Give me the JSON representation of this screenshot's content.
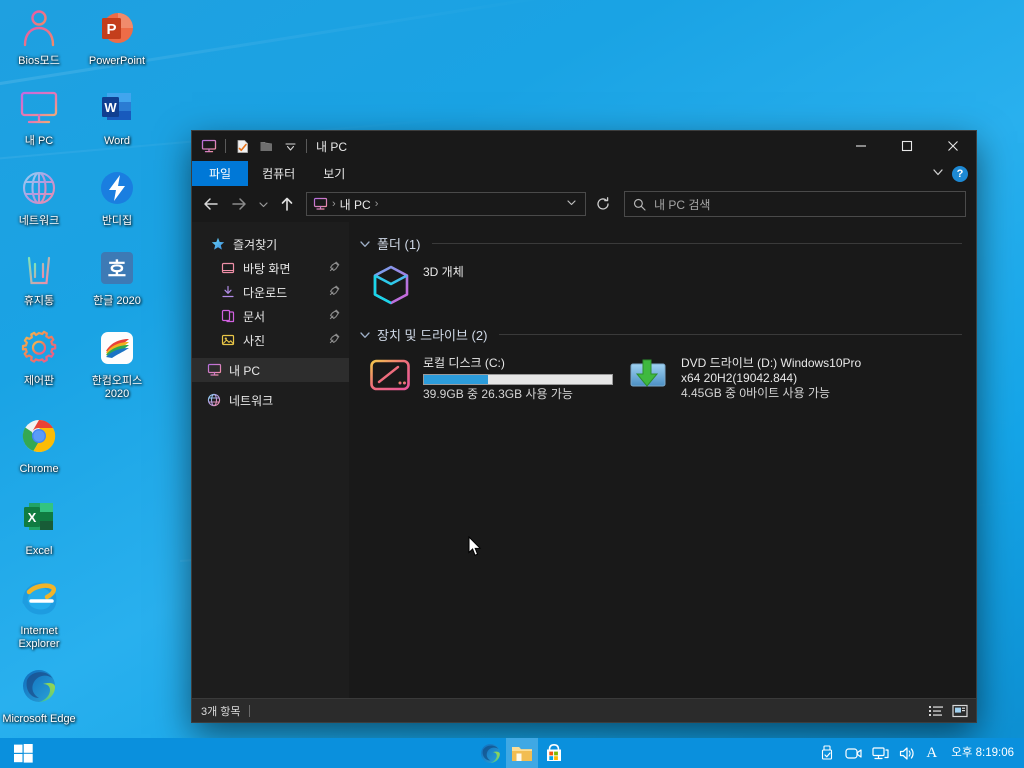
{
  "desktop": {
    "icons": [
      {
        "label": "Bios모드",
        "icon": "person-outline-icon"
      },
      {
        "label": "PowerPoint",
        "icon": "powerpoint-icon"
      },
      {
        "label": "내 PC",
        "icon": "this-pc-icon"
      },
      {
        "label": "Word",
        "icon": "word-icon"
      },
      {
        "label": "네트워크",
        "icon": "network-globe-icon"
      },
      {
        "label": "반디집",
        "icon": "bandizip-icon"
      },
      {
        "label": "휴지통",
        "icon": "recycle-bin-icon"
      },
      {
        "label": "한글 2020",
        "icon": "hangul-icon"
      },
      {
        "label": "제어판",
        "icon": "control-panel-gear-icon"
      },
      {
        "label": "한컴오피스 2020",
        "icon": "hancom-office-icon"
      },
      {
        "label": "Chrome",
        "icon": "chrome-icon"
      },
      {
        "label": "Excel",
        "icon": "excel-icon"
      },
      {
        "label": "Internet Explorer",
        "icon": "internet-explorer-icon"
      },
      {
        "label": "Microsoft Edge",
        "icon": "edge-icon"
      }
    ]
  },
  "explorer": {
    "title": "내 PC",
    "quick_access": {
      "this_pc_icon": "this-pc-icon",
      "properties_icon": "properties-icon",
      "new_folder_icon": "new-folder-icon",
      "customize_icon": "chevron-down-icon"
    },
    "window_controls": {
      "minimize": "—",
      "maximize": "□",
      "close": "✕"
    },
    "ribbon": {
      "tabs": [
        {
          "label": "파일",
          "active": true
        },
        {
          "label": "컴퓨터",
          "active": false
        },
        {
          "label": "보기",
          "active": false
        }
      ],
      "collapse_icon": "chevron-down-icon",
      "help_label": "?"
    },
    "nav": {
      "back_icon": "arrow-left-icon",
      "forward_icon": "arrow-right-icon",
      "recent_icon": "chevron-down-icon",
      "up_icon": "arrow-up-icon",
      "breadcrumb": [
        "내 PC"
      ],
      "breadcrumb_icon": "this-pc-icon",
      "dropdown_icon": "chevron-down-icon",
      "refresh_icon": "refresh-icon"
    },
    "search": {
      "placeholder": "내 PC 검색",
      "icon": "search-icon"
    },
    "sidebar": {
      "items": [
        {
          "label": "즐겨찾기",
          "icon": "star-icon",
          "level": "group",
          "pinned": false,
          "selected": false
        },
        {
          "label": "바탕 화면",
          "icon": "desktop-icon",
          "level": "child",
          "pinned": true,
          "selected": false
        },
        {
          "label": "다운로드",
          "icon": "download-icon",
          "level": "child",
          "pinned": true,
          "selected": false
        },
        {
          "label": "문서",
          "icon": "documents-icon",
          "level": "child",
          "pinned": true,
          "selected": false
        },
        {
          "label": "사진",
          "icon": "pictures-icon",
          "level": "child",
          "pinned": true,
          "selected": false
        },
        {
          "label": "내 PC",
          "icon": "this-pc-icon",
          "level": "root",
          "pinned": false,
          "selected": true
        },
        {
          "label": "네트워크",
          "icon": "network-globe-icon",
          "level": "root",
          "pinned": false,
          "selected": false
        }
      ]
    },
    "groups": [
      {
        "title": "폴더 (1)",
        "collapse_icon": "chevron-down-icon",
        "items": [
          {
            "name": "3D 개체",
            "icon": "3d-objects-icon"
          }
        ]
      },
      {
        "title": "장치 및 드라이브 (2)",
        "collapse_icon": "chevron-down-icon",
        "items": [
          {
            "name": "로컬 디스크 (C:)",
            "icon": "hard-drive-icon",
            "capacity_text": "39.9GB 중 26.3GB 사용 가능",
            "used_percent": 34
          },
          {
            "name_line1": "DVD 드라이브 (D:) Windows10Pro",
            "name_line2": "x64 20H2(19042.844)",
            "icon": "dvd-drive-icon",
            "capacity_text": "4.45GB 중 0바이트 사용 가능"
          }
        ]
      }
    ],
    "statusbar": {
      "item_count": "3개 항목",
      "details_view_icon": "details-view-icon",
      "large_icons_view_icon": "large-icons-view-icon"
    }
  },
  "taskbar": {
    "start_icon": "windows-start-icon",
    "apps": [
      {
        "name": "Microsoft Edge",
        "icon": "edge-icon",
        "active": false
      },
      {
        "name": "파일 탐색기",
        "icon": "file-explorer-icon",
        "active": true
      },
      {
        "name": "Microsoft Store",
        "icon": "microsoft-store-icon",
        "active": false
      }
    ],
    "tray": [
      {
        "name": "safely-remove-hardware-icon"
      },
      {
        "name": "camera-icon"
      },
      {
        "name": "network-icon"
      },
      {
        "name": "volume-icon"
      },
      {
        "name": "ime-alpha-icon",
        "label": "A"
      }
    ],
    "clock": "오후 8:19:06"
  },
  "colors": {
    "accent_blue": "#0078d7",
    "taskbar_blue": "#0a90dd",
    "window_bg": "#191919",
    "navpane_bg": "#1d1d1d",
    "selection_bg": "#2d2d2d",
    "progress_fill": "#2c9cdb",
    "statusbar_bg": "#2b2b2b"
  }
}
